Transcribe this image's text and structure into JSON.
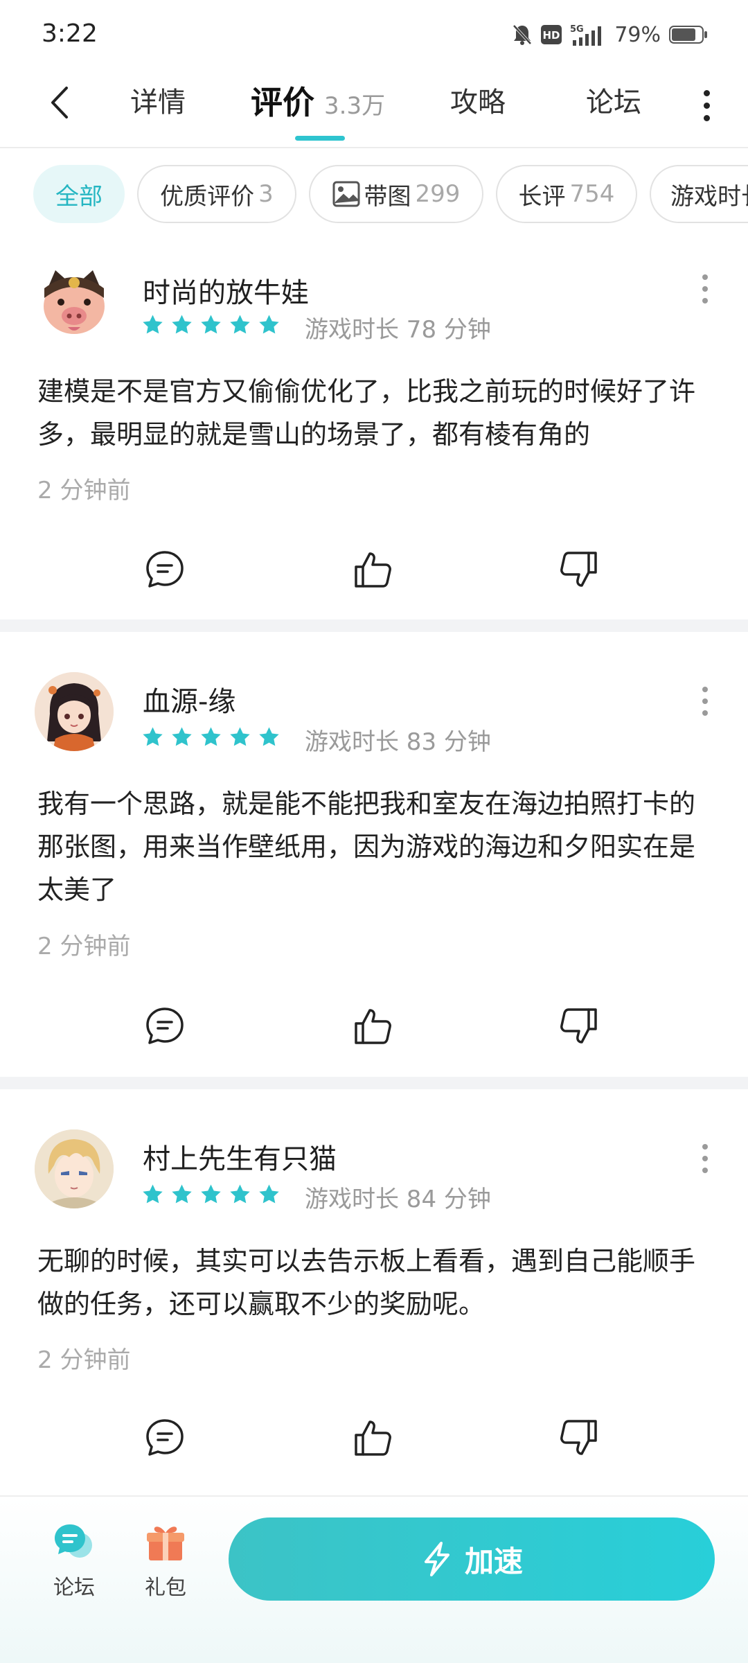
{
  "status": {
    "time": "3:22",
    "battery": "79%",
    "network": "5G",
    "hd": "HD"
  },
  "header": {
    "tabs": [
      {
        "label": "详情"
      },
      {
        "label": "评价",
        "count": "3.3万",
        "active": true
      },
      {
        "label": "攻略"
      },
      {
        "label": "论坛"
      }
    ]
  },
  "filters": [
    {
      "label": "全部",
      "count": "",
      "active": true
    },
    {
      "label": "优质评价",
      "count": "3"
    },
    {
      "label": "带图",
      "count": "299"
    },
    {
      "label": "长评",
      "count": "754"
    },
    {
      "label": "游戏时长",
      "count": ""
    }
  ],
  "reviews": [
    {
      "username": "时尚的放牛娃",
      "rating": 5,
      "playtime": "游戏时长 78 分钟",
      "text": "建模是不是官方又偷偷优化了，比我之前玩的时候好了许多，最明显的就是雪山的场景了，都有棱有角的",
      "time": "2 分钟前"
    },
    {
      "username": "血源-缘",
      "rating": 5,
      "playtime": "游戏时长 83 分钟",
      "text": "我有一个思路，就是能不能把我和室友在海边拍照打卡的那张图，用来当作壁纸用，因为游戏的海边和夕阳实在是太美了",
      "time": "2 分钟前"
    },
    {
      "username": "村上先生有只猫",
      "rating": 5,
      "playtime": "游戏时长 84 分钟",
      "text": "无聊的时候，其实可以去告示板上看看，遇到自己能顺手做的任务，还可以赢取不少的奖励呢。",
      "time": "2 分钟前"
    }
  ],
  "bottom": {
    "forum_label": "论坛",
    "gift_label": "礼包",
    "boost_label": "加速"
  },
  "colors": {
    "accent": "#2ec4cf",
    "star": "#2fc3cc",
    "boost_start": "#3cc3c6",
    "boost_end": "#28cfd9"
  }
}
